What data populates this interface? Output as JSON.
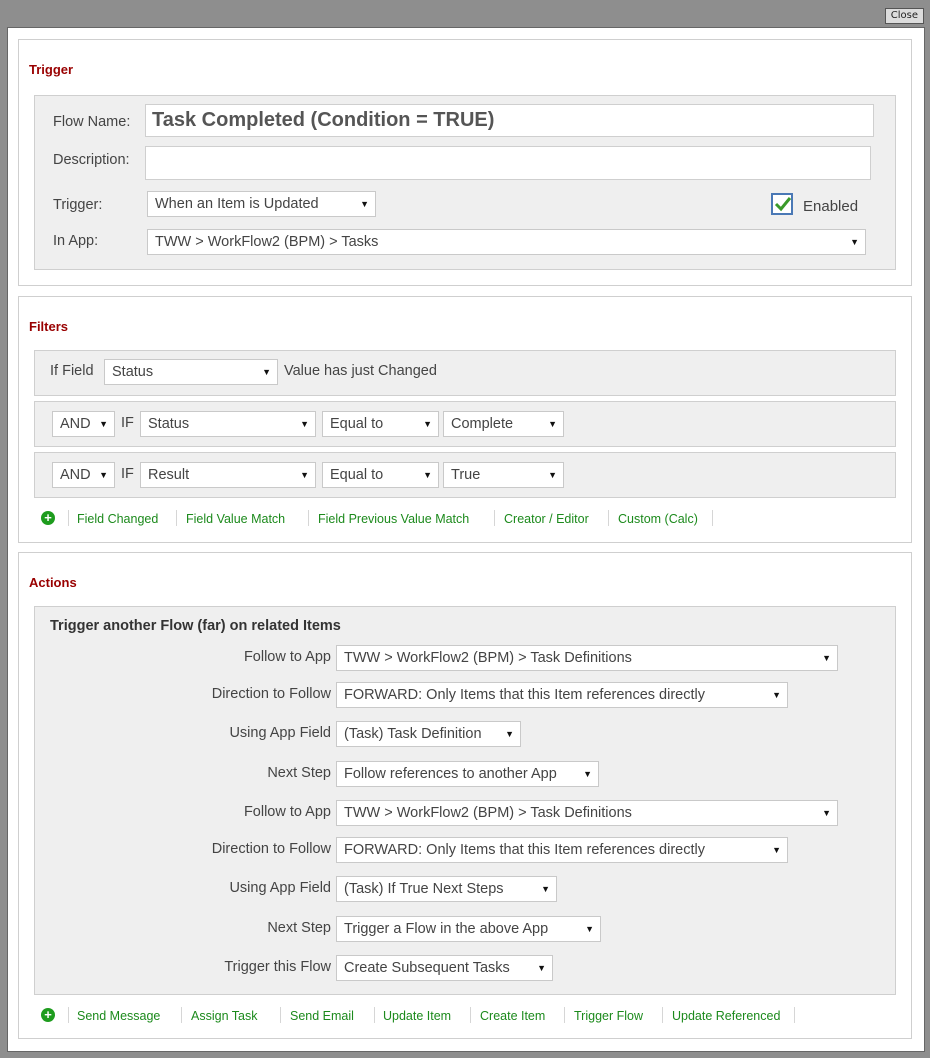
{
  "dialog": {
    "close_label": "Close"
  },
  "trigger": {
    "section_title": "Trigger",
    "flow_name_label": "Flow Name:",
    "flow_name_value": "Task Completed (Condition = TRUE)",
    "description_label": "Description:",
    "description_value": "",
    "trigger_label": "Trigger:",
    "trigger_value": "When an Item is Updated",
    "enabled_label": "Enabled",
    "enabled_checked": true,
    "in_app_label": "In App:",
    "in_app_value": "TWW > WorkFlow2 (BPM) > Tasks"
  },
  "filters": {
    "section_title": "Filters",
    "first_row": {
      "prefix": "If Field",
      "field": "Status",
      "suffix": "Value has just Changed"
    },
    "rows": [
      {
        "conj": "AND",
        "if": "IF",
        "field": "Status",
        "operator": "Equal to",
        "value": "Complete"
      },
      {
        "conj": "AND",
        "if": "IF",
        "field": "Result",
        "operator": "Equal to",
        "value": "True"
      }
    ],
    "add_links": [
      "Field Changed",
      "Field Value Match",
      "Field Previous Value Match",
      "Creator / Editor",
      "Custom (Calc)"
    ]
  },
  "actions": {
    "section_title": "Actions",
    "box_title": "Trigger another Flow (far) on related Items",
    "rows": [
      {
        "label": "Follow to App",
        "value": "TWW > WorkFlow2 (BPM) > Task Definitions"
      },
      {
        "label": "Direction to Follow",
        "value": "FORWARD: Only Items that this Item references directly"
      },
      {
        "label": "Using App Field",
        "value": "(Task) Task Definition"
      },
      {
        "label": "Next Step",
        "value": "Follow references to another App"
      },
      {
        "label": "Follow to App",
        "value": "TWW > WorkFlow2 (BPM) > Task Definitions"
      },
      {
        "label": "Direction to Follow",
        "value": "FORWARD: Only Items that this Item references directly"
      },
      {
        "label": "Using App Field",
        "value": "(Task) If True Next Steps"
      },
      {
        "label": "Next Step",
        "value": "Trigger a Flow in the above App"
      },
      {
        "label": "Trigger this Flow",
        "value": "Create Subsequent Tasks"
      }
    ],
    "add_links": [
      "Send Message",
      "Assign Task",
      "Send Email",
      "Update Item",
      "Create Item",
      "Trigger Flow",
      "Update Referenced"
    ]
  },
  "icons": {
    "plus": "plus-circle-icon",
    "arrow": "dropdown-arrow-icon",
    "check": "check-icon"
  },
  "colors": {
    "section_title": "#990000",
    "link": "#1c8a1c",
    "checkbox_border": "#4a78b5",
    "check_mark": "#3a9a2a"
  }
}
